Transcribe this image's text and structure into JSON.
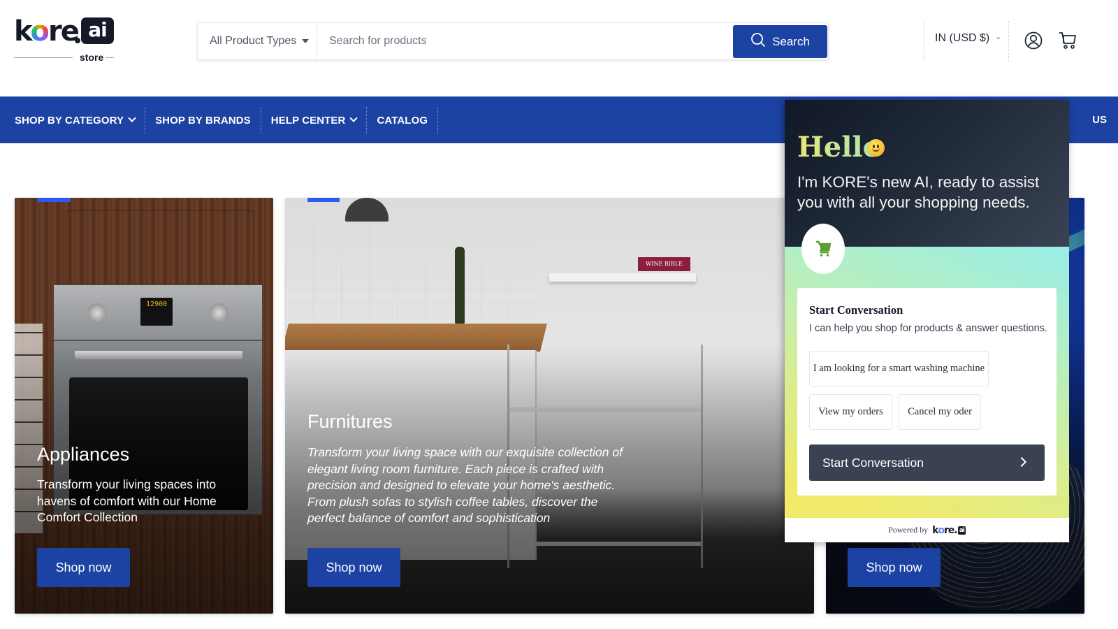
{
  "brand": {
    "logo_text_k": "k",
    "logo_text_o": "o",
    "logo_text_re": "re",
    "logo_ai": "ai",
    "logo_sub": "store"
  },
  "search": {
    "product_type_selected": "All Product Types",
    "placeholder": "Search for products",
    "value": "",
    "button_label": "Search",
    "button_icon": "search-icon"
  },
  "header_right": {
    "region_label": "IN (USD $)",
    "account_icon": "user-circle-icon",
    "cart_icon": "cart-icon"
  },
  "nav": {
    "items": [
      {
        "label": "SHOP BY CATEGORY",
        "has_dropdown": true
      },
      {
        "label": "SHOP BY BRANDS",
        "has_dropdown": false
      },
      {
        "label": "HELP CENTER",
        "has_dropdown": true
      },
      {
        "label": "CATALOG",
        "has_dropdown": false
      }
    ],
    "right_partial_label": "US"
  },
  "cards": [
    {
      "title": "Appliances",
      "description": "Transform your living spaces into havens of comfort with our Home Comfort Collection",
      "button_label": "Shop now",
      "oven_display": "12900"
    },
    {
      "title": "Furnitures",
      "description": "Transform your living space with our exquisite collection of elegant living room furniture. Each piece is crafted with precision and designed to elevate your home's aesthetic. From plush sofas to stylish coffee tables, discover the perfect balance of comfort and sophistication",
      "button_label": "Shop now",
      "book_label": "WINE BIBLE"
    },
    {
      "title": "",
      "description": "",
      "button_label": "Shop now"
    }
  ],
  "chat": {
    "greeting": "Hello",
    "greeting_emoji": "slightly-smiling-face",
    "intro": "I'm KORE's new AI, ready to assist you with all your shopping needs.",
    "avatar_icon": "cart-icon",
    "card": {
      "title": "Start Conversation",
      "subtitle": "I can help you shop for products & answer questions.",
      "suggestions": [
        "I am looking for a smart washing machine",
        "View my orders",
        "Cancel my oder"
      ],
      "start_button_label": "Start Conversation"
    },
    "footer": {
      "powered_by": "Powered by",
      "logo_k": "k",
      "logo_o": "o",
      "logo_re": "re.",
      "logo_ai": "ai"
    }
  },
  "colors": {
    "brand_blue": "#1c42a3",
    "accent_blue": "#2b5bf0",
    "chat_dark": "#1f2937",
    "chat_button": "#394153",
    "cart_green": "#5c9e2e"
  }
}
